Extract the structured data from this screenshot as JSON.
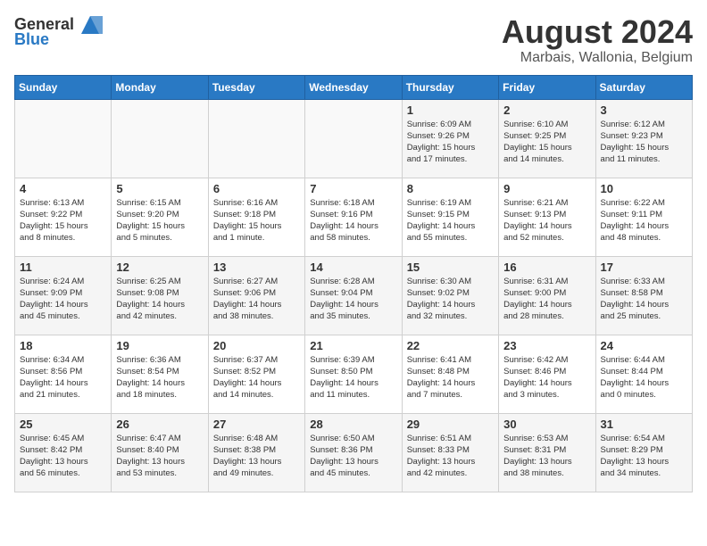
{
  "header": {
    "logo_general": "General",
    "logo_blue": "Blue",
    "month_year": "August 2024",
    "location": "Marbais, Wallonia, Belgium"
  },
  "days_of_week": [
    "Sunday",
    "Monday",
    "Tuesday",
    "Wednesday",
    "Thursday",
    "Friday",
    "Saturday"
  ],
  "weeks": [
    [
      {
        "day": "",
        "info": ""
      },
      {
        "day": "",
        "info": ""
      },
      {
        "day": "",
        "info": ""
      },
      {
        "day": "",
        "info": ""
      },
      {
        "day": "1",
        "info": "Sunrise: 6:09 AM\nSunset: 9:26 PM\nDaylight: 15 hours\nand 17 minutes."
      },
      {
        "day": "2",
        "info": "Sunrise: 6:10 AM\nSunset: 9:25 PM\nDaylight: 15 hours\nand 14 minutes."
      },
      {
        "day": "3",
        "info": "Sunrise: 6:12 AM\nSunset: 9:23 PM\nDaylight: 15 hours\nand 11 minutes."
      }
    ],
    [
      {
        "day": "4",
        "info": "Sunrise: 6:13 AM\nSunset: 9:22 PM\nDaylight: 15 hours\nand 8 minutes."
      },
      {
        "day": "5",
        "info": "Sunrise: 6:15 AM\nSunset: 9:20 PM\nDaylight: 15 hours\nand 5 minutes."
      },
      {
        "day": "6",
        "info": "Sunrise: 6:16 AM\nSunset: 9:18 PM\nDaylight: 15 hours\nand 1 minute."
      },
      {
        "day": "7",
        "info": "Sunrise: 6:18 AM\nSunset: 9:16 PM\nDaylight: 14 hours\nand 58 minutes."
      },
      {
        "day": "8",
        "info": "Sunrise: 6:19 AM\nSunset: 9:15 PM\nDaylight: 14 hours\nand 55 minutes."
      },
      {
        "day": "9",
        "info": "Sunrise: 6:21 AM\nSunset: 9:13 PM\nDaylight: 14 hours\nand 52 minutes."
      },
      {
        "day": "10",
        "info": "Sunrise: 6:22 AM\nSunset: 9:11 PM\nDaylight: 14 hours\nand 48 minutes."
      }
    ],
    [
      {
        "day": "11",
        "info": "Sunrise: 6:24 AM\nSunset: 9:09 PM\nDaylight: 14 hours\nand 45 minutes."
      },
      {
        "day": "12",
        "info": "Sunrise: 6:25 AM\nSunset: 9:08 PM\nDaylight: 14 hours\nand 42 minutes."
      },
      {
        "day": "13",
        "info": "Sunrise: 6:27 AM\nSunset: 9:06 PM\nDaylight: 14 hours\nand 38 minutes."
      },
      {
        "day": "14",
        "info": "Sunrise: 6:28 AM\nSunset: 9:04 PM\nDaylight: 14 hours\nand 35 minutes."
      },
      {
        "day": "15",
        "info": "Sunrise: 6:30 AM\nSunset: 9:02 PM\nDaylight: 14 hours\nand 32 minutes."
      },
      {
        "day": "16",
        "info": "Sunrise: 6:31 AM\nSunset: 9:00 PM\nDaylight: 14 hours\nand 28 minutes."
      },
      {
        "day": "17",
        "info": "Sunrise: 6:33 AM\nSunset: 8:58 PM\nDaylight: 14 hours\nand 25 minutes."
      }
    ],
    [
      {
        "day": "18",
        "info": "Sunrise: 6:34 AM\nSunset: 8:56 PM\nDaylight: 14 hours\nand 21 minutes."
      },
      {
        "day": "19",
        "info": "Sunrise: 6:36 AM\nSunset: 8:54 PM\nDaylight: 14 hours\nand 18 minutes."
      },
      {
        "day": "20",
        "info": "Sunrise: 6:37 AM\nSunset: 8:52 PM\nDaylight: 14 hours\nand 14 minutes."
      },
      {
        "day": "21",
        "info": "Sunrise: 6:39 AM\nSunset: 8:50 PM\nDaylight: 14 hours\nand 11 minutes."
      },
      {
        "day": "22",
        "info": "Sunrise: 6:41 AM\nSunset: 8:48 PM\nDaylight: 14 hours\nand 7 minutes."
      },
      {
        "day": "23",
        "info": "Sunrise: 6:42 AM\nSunset: 8:46 PM\nDaylight: 14 hours\nand 3 minutes."
      },
      {
        "day": "24",
        "info": "Sunrise: 6:44 AM\nSunset: 8:44 PM\nDaylight: 14 hours\nand 0 minutes."
      }
    ],
    [
      {
        "day": "25",
        "info": "Sunrise: 6:45 AM\nSunset: 8:42 PM\nDaylight: 13 hours\nand 56 minutes."
      },
      {
        "day": "26",
        "info": "Sunrise: 6:47 AM\nSunset: 8:40 PM\nDaylight: 13 hours\nand 53 minutes."
      },
      {
        "day": "27",
        "info": "Sunrise: 6:48 AM\nSunset: 8:38 PM\nDaylight: 13 hours\nand 49 minutes."
      },
      {
        "day": "28",
        "info": "Sunrise: 6:50 AM\nSunset: 8:36 PM\nDaylight: 13 hours\nand 45 minutes."
      },
      {
        "day": "29",
        "info": "Sunrise: 6:51 AM\nSunset: 8:33 PM\nDaylight: 13 hours\nand 42 minutes."
      },
      {
        "day": "30",
        "info": "Sunrise: 6:53 AM\nSunset: 8:31 PM\nDaylight: 13 hours\nand 38 minutes."
      },
      {
        "day": "31",
        "info": "Sunrise: 6:54 AM\nSunset: 8:29 PM\nDaylight: 13 hours\nand 34 minutes."
      }
    ]
  ]
}
